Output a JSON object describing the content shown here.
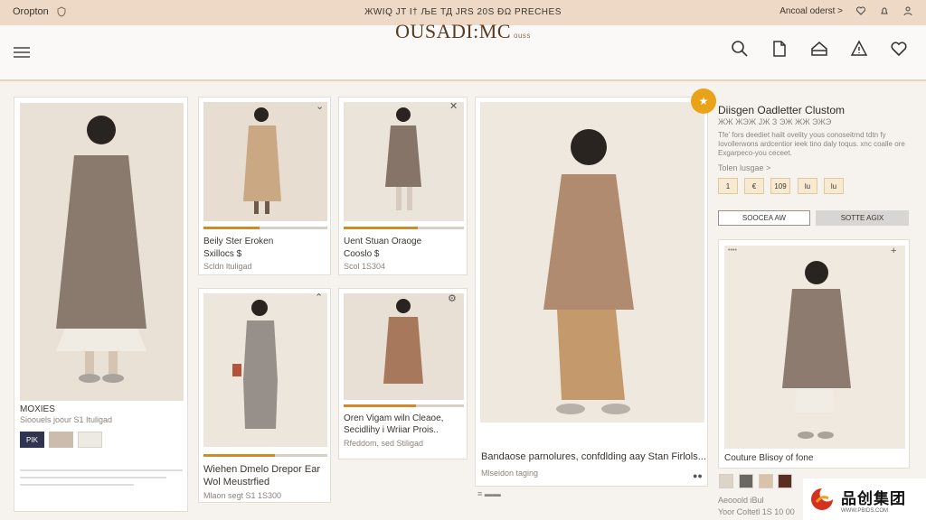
{
  "topbar": {
    "left_label": "Oropton",
    "promo": "ЖWIQ ЈT I† ЉЕ ТД ЈRS 20Ѕ ĐΩ PRECHES",
    "account": "Ancoal oderst >"
  },
  "header": {
    "brand": "OUSADI:MC",
    "brand_suffix": "ouss"
  },
  "products": [
    {
      "title": "MOXIES",
      "subtitle": "Sioouels joour S1 Ituligad",
      "price": "",
      "swatches": [
        "PIK",
        "",
        ""
      ]
    },
    {
      "title": "Beily Ster Eroken",
      "subtitle": "Sxillocs $",
      "price": "Scldn ltuligad",
      "progress": 0.45
    },
    {
      "title": "Uent Stuan Oraoge",
      "subtitle": "Cooslo $",
      "price": "Scol 1S304",
      "progress": 0.62
    },
    {
      "title": "Wiehen Dmelo Drepor Ear",
      "subtitle": "Wol Meustrfied",
      "price": "Mlaon segt S1 1S300",
      "progress": 0.58
    },
    {
      "title": "Oren Vigam wiln Cleaoe,",
      "subtitle": "Secidlihy i Wriiar Prois..",
      "price": "Rfeddom, sed Stiligad",
      "progress": 0.6
    },
    {
      "title": "Bandaose parnolures, confdlding aay Stan Firlols...",
      "subtitle": "Mlseidon taging",
      "price": "",
      "progress": 0
    }
  ],
  "detail": {
    "title": "Diisgen Oadletter Clustom",
    "subtitle": "ЖЖ ЖЭЖ ЈЖ З ЭЖ ЖЖ ЭЖЭ",
    "desc_lines": [
      "Tfe’ fors deediet hailt ovelity yous conoseitrnd tdtn fy",
      "Iovollerwons ardcentior ieek tino daly toqus. xnc coalle ore",
      "Exgarpeco-you ceceet."
    ],
    "size_label": "Tolen lusgae >",
    "sizes": [
      "1",
      "€",
      "109",
      "lu",
      "lu"
    ],
    "btn_primary": "SOOCEA AW",
    "btn_secondary": "SOTTE AGIX",
    "related_title": "Couture Blisoy of fone",
    "related_colors": [
      "#ddd4c8",
      "#6a6660",
      "#d8c2aa",
      "#5a2e22"
    ],
    "footer_lines": [
      "Aeooold iBul",
      "Yoor Coltetl 1S 10 00"
    ],
    "badge": "★"
  },
  "icons": {
    "topbar_left": "shield-icon",
    "topbar_right": [
      "heart-icon",
      "bell-icon",
      "user-icon"
    ],
    "header": [
      "search-icon",
      "document-icon",
      "home-icon",
      "warning-icon",
      "heart-icon"
    ]
  },
  "watermark": {
    "cn": "品创集团",
    "url": "WWW.PBIDS.COM"
  }
}
